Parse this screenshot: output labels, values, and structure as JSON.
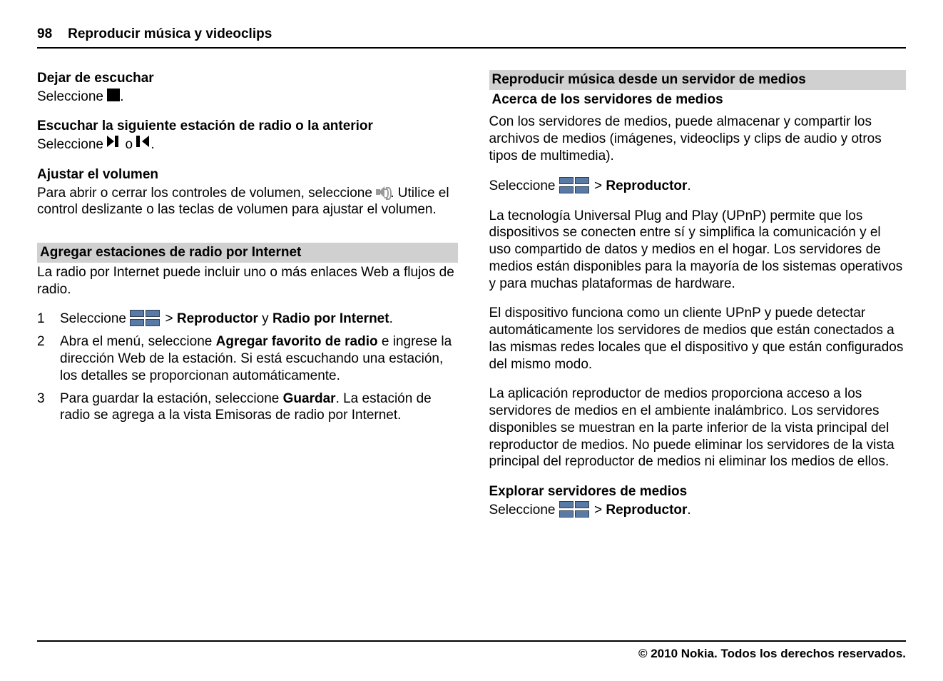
{
  "header": {
    "page_number": "98",
    "title": "Reproducir música y videoclips"
  },
  "left": {
    "stop_listening": {
      "heading": "Dejar de escuchar",
      "select": "Seleccione",
      "period": "."
    },
    "next_prev": {
      "heading": "Escuchar la siguiente estación de radio o la anterior",
      "select": "Seleccione",
      "or": " o ",
      "period": "."
    },
    "volume": {
      "heading": "Ajustar el volumen",
      "line": "Para abrir o cerrar los controles de volumen, seleccione ",
      "period": ".",
      "rest": "Utilice el control deslizante o las teclas de volumen para ajustar el volumen."
    },
    "internet_radio_bar": "Agregar estaciones de radio por Internet",
    "internet_radio_intro": "La radio por Internet puede incluir uno o más enlaces Web a flujos de radio.",
    "step1": {
      "n": "1",
      "pre": "Seleccione ",
      "gt": " > ",
      "bold1": "Reproductor",
      "mid": " y ",
      "bold2": "Radio por Internet",
      "end": "."
    },
    "step2": {
      "n": "2",
      "pre": "Abra el menú, seleccione ",
      "bold": "Agregar favorito de radio",
      "rest": " e ingrese la dirección Web de la estación. Si está escuchando una estación, los detalles se proporcionan automáticamente."
    },
    "step3": {
      "n": "3",
      "pre": "Para guardar la estación, seleccione ",
      "bold": "Guardar",
      "rest": ". La estación de radio se agrega a la vista Emisoras de radio por Internet."
    }
  },
  "right": {
    "bar1": "Reproducir música desde un servidor de medios",
    "bar2": "Acerca de los servidores de medios",
    "p1": "Con los servidores de medios, puede almacenar y compartir los archivos de medios (imágenes, videoclips y clips de audio y otros tipos de multimedia).",
    "select_line": {
      "pre": "Seleccione ",
      "gt": " > ",
      "bold": "Reproductor",
      "end": "."
    },
    "p2": "La tecnología Universal Plug and Play (UPnP) permite que los dispositivos se conecten entre sí y simplifica la comunicación y el uso compartido de datos y medios en el hogar. Los servidores de medios están disponibles para la mayoría de los sistemas operativos y para muchas plataformas de hardware.",
    "p3": "El dispositivo funciona como un cliente UPnP y puede detectar automáticamente los servidores de medios que están conectados a las mismas redes locales que el dispositivo y que están configurados del mismo modo.",
    "p4": "La aplicación reproductor de medios proporciona acceso a los servidores de medios en el ambiente inalámbrico. Los servidores disponibles se muestran en la parte inferior de la vista principal del reproductor de medios. No puede eliminar los servidores de la vista principal del reproductor de medios ni eliminar los medios de ellos.",
    "explore_heading": "Explorar servidores de medios",
    "explore_line": {
      "pre": "Seleccione ",
      "gt": " > ",
      "bold": "Reproductor",
      "end": "."
    }
  },
  "footer": "© 2010 Nokia. Todos los derechos reservados."
}
